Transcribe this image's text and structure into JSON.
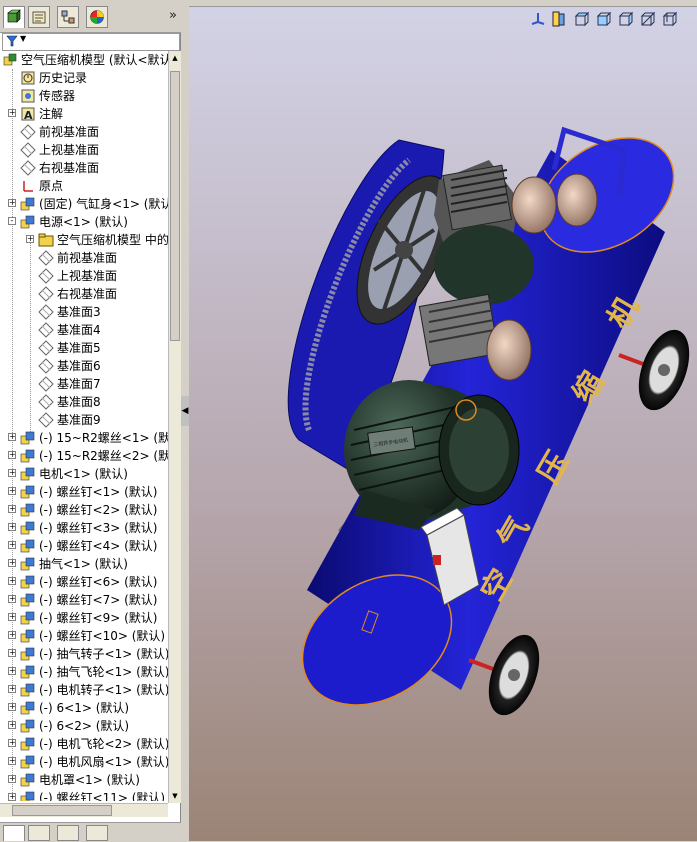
{
  "tree": {
    "items": [
      {
        "label": "空气压缩机模型  (默认<默认",
        "icon": "assembly-icon",
        "level": 0,
        "expand": ""
      },
      {
        "label": "历史记录",
        "icon": "history-icon",
        "level": 1,
        "expand": ""
      },
      {
        "label": "传感器",
        "icon": "sensor-icon",
        "level": 1,
        "expand": ""
      },
      {
        "label": "注解",
        "icon": "annotation-icon",
        "level": 1,
        "expand": "+"
      },
      {
        "label": "前视基准面",
        "icon": "plane-icon",
        "level": 1,
        "expand": ""
      },
      {
        "label": "上视基准面",
        "icon": "plane-icon",
        "level": 1,
        "expand": ""
      },
      {
        "label": "右视基准面",
        "icon": "plane-icon",
        "level": 1,
        "expand": ""
      },
      {
        "label": "原点",
        "icon": "origin-icon",
        "level": 1,
        "expand": ""
      },
      {
        "label": "(固定) 气缸身<1> (默认",
        "icon": "part-icon",
        "level": 1,
        "expand": "+"
      },
      {
        "label": "电源<1> (默认)",
        "icon": "part-icon",
        "level": 1,
        "expand": "-"
      },
      {
        "label": "空气压缩机模型 中的",
        "icon": "folder-icon",
        "level": 2,
        "expand": "+"
      },
      {
        "label": "前视基准面",
        "icon": "plane-icon",
        "level": 2,
        "expand": ""
      },
      {
        "label": "上视基准面",
        "icon": "plane-icon",
        "level": 2,
        "expand": ""
      },
      {
        "label": "右视基准面",
        "icon": "plane-icon",
        "level": 2,
        "expand": ""
      },
      {
        "label": "基准面3",
        "icon": "plane-icon",
        "level": 2,
        "expand": ""
      },
      {
        "label": "基准面4",
        "icon": "plane-icon",
        "level": 2,
        "expand": ""
      },
      {
        "label": "基准面5",
        "icon": "plane-icon",
        "level": 2,
        "expand": ""
      },
      {
        "label": "基准面6",
        "icon": "plane-icon",
        "level": 2,
        "expand": ""
      },
      {
        "label": "基准面7",
        "icon": "plane-icon",
        "level": 2,
        "expand": ""
      },
      {
        "label": "基准面8",
        "icon": "plane-icon",
        "level": 2,
        "expand": ""
      },
      {
        "label": "基准面9",
        "icon": "plane-icon",
        "level": 2,
        "expand": ""
      },
      {
        "label": "(-) 15~R2螺丝<1> (默",
        "icon": "part-icon",
        "level": 1,
        "expand": "+"
      },
      {
        "label": "(-) 15~R2螺丝<2> (默",
        "icon": "part-icon",
        "level": 1,
        "expand": "+"
      },
      {
        "label": "电机<1> (默认)",
        "icon": "part-icon",
        "level": 1,
        "expand": "+"
      },
      {
        "label": "(-) 螺丝钉<1> (默认)",
        "icon": "part-icon",
        "level": 1,
        "expand": "+"
      },
      {
        "label": "(-) 螺丝钉<2> (默认)",
        "icon": "part-icon",
        "level": 1,
        "expand": "+"
      },
      {
        "label": "(-) 螺丝钉<3> (默认)",
        "icon": "part-icon",
        "level": 1,
        "expand": "+"
      },
      {
        "label": "(-) 螺丝钉<4> (默认)",
        "icon": "part-icon",
        "level": 1,
        "expand": "+"
      },
      {
        "label": "抽气<1> (默认)",
        "icon": "part-icon",
        "level": 1,
        "expand": "+"
      },
      {
        "label": "(-) 螺丝钉<6> (默认)",
        "icon": "part-icon",
        "level": 1,
        "expand": "+"
      },
      {
        "label": "(-) 螺丝钉<7> (默认)",
        "icon": "part-icon",
        "level": 1,
        "expand": "+"
      },
      {
        "label": "(-) 螺丝钉<9> (默认)",
        "icon": "part-icon",
        "level": 1,
        "expand": "+"
      },
      {
        "label": "(-) 螺丝钉<10> (默认)",
        "icon": "part-icon",
        "level": 1,
        "expand": "+"
      },
      {
        "label": "(-) 抽气转子<1> (默认)",
        "icon": "part-icon",
        "level": 1,
        "expand": "+"
      },
      {
        "label": "(-) 抽气飞轮<1> (默认)",
        "icon": "part-icon",
        "level": 1,
        "expand": "+"
      },
      {
        "label": "(-) 电机转子<1> (默认)",
        "icon": "part-icon",
        "level": 1,
        "expand": "+"
      },
      {
        "label": "(-) 6<1> (默认)",
        "icon": "part-icon",
        "level": 1,
        "expand": "+"
      },
      {
        "label": "(-) 6<2> (默认)",
        "icon": "part-icon",
        "level": 1,
        "expand": "+"
      },
      {
        "label": "(-) 电机飞轮<2> (默认)",
        "icon": "part-icon",
        "level": 1,
        "expand": "+"
      },
      {
        "label": "(-) 电机风扇<1> (默认)",
        "icon": "part-icon",
        "level": 1,
        "expand": "+"
      },
      {
        "label": "电机罩<1> (默认)",
        "icon": "part-icon",
        "level": 1,
        "expand": "+"
      },
      {
        "label": "(-) 螺丝钉<11> (默认)",
        "icon": "part-icon",
        "level": 1,
        "expand": "+"
      }
    ]
  },
  "tabs": {
    "collapse_glyph": "»"
  },
  "filter": {
    "glyph": "▼"
  },
  "model": {
    "tank_lettering": [
      "空",
      "气",
      "压",
      "缩",
      "机"
    ],
    "motor_plate": "三相异步电动机"
  },
  "colors": {
    "tank": "#1a1ab4",
    "tank_dark": "#0a0a70",
    "motor": "#1f3328",
    "accent": "#e08a1e"
  }
}
